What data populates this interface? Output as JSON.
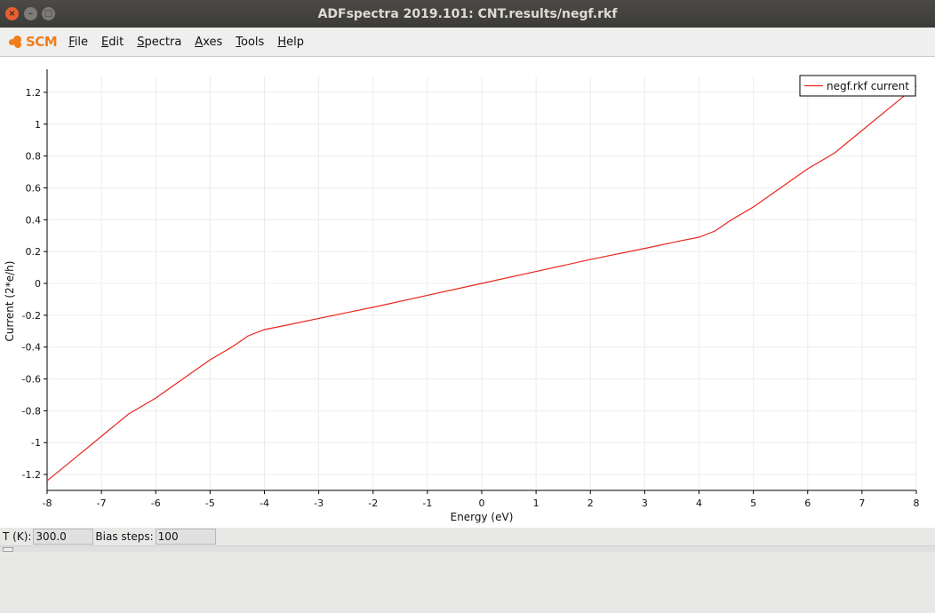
{
  "window": {
    "title": "ADFspectra 2019.101: CNT.results/negf.rkf",
    "close_glyph": "×",
    "min_glyph": "–",
    "max_glyph": "□"
  },
  "menubar": {
    "logo_text": "SCM",
    "items": [
      "File",
      "Edit",
      "Spectra",
      "Axes",
      "Tools",
      "Help"
    ]
  },
  "statusbar": {
    "temperature_label": "T (K):",
    "temperature_value": "300.0",
    "bias_label": "Bias steps:",
    "bias_value": "100"
  },
  "colors": {
    "series": "#e8261c",
    "grid": "#ececec",
    "logo": "#f07e1c"
  },
  "chart_data": {
    "type": "line",
    "xlabel": "Energy (eV)",
    "ylabel": "Current (2*e/h)",
    "xlim": [
      -8,
      8
    ],
    "ylim": [
      -1.3,
      1.3
    ],
    "xticks": [
      -8,
      -7,
      -6,
      -5,
      -4,
      -3,
      -2,
      -1,
      0,
      1,
      2,
      3,
      4,
      5,
      6,
      7,
      8
    ],
    "yticks": [
      -1.2,
      -1,
      -0.8,
      -0.6,
      -0.4,
      -0.2,
      0,
      0.2,
      0.4,
      0.6,
      0.8,
      1,
      1.2
    ],
    "ytick_labels": [
      "-1.2",
      "-1",
      "-0.8",
      "-0.6",
      "-0.4",
      "-0.2",
      "0",
      "0.2",
      "0.4",
      "0.6",
      "0.8",
      "1",
      "1.2"
    ],
    "grid": true,
    "legend_position": "top-right",
    "series": [
      {
        "name": "negf.rkf current",
        "x": [
          -8,
          -7.5,
          -7,
          -6.5,
          -6,
          -5.5,
          -5,
          -4.6,
          -4.3,
          -4,
          -3.7,
          -3,
          -2,
          -1,
          0,
          1,
          2,
          3,
          3.7,
          4,
          4.3,
          4.6,
          5,
          5.5,
          6,
          6.5,
          7,
          7.5,
          8
        ],
        "y": [
          -1.24,
          -1.1,
          -0.96,
          -0.82,
          -0.72,
          -0.6,
          -0.48,
          -0.4,
          -0.33,
          -0.29,
          -0.27,
          -0.22,
          -0.15,
          -0.075,
          0,
          0.075,
          0.15,
          0.22,
          0.27,
          0.29,
          0.33,
          0.4,
          0.48,
          0.6,
          0.72,
          0.82,
          0.96,
          1.1,
          1.24
        ]
      }
    ]
  }
}
